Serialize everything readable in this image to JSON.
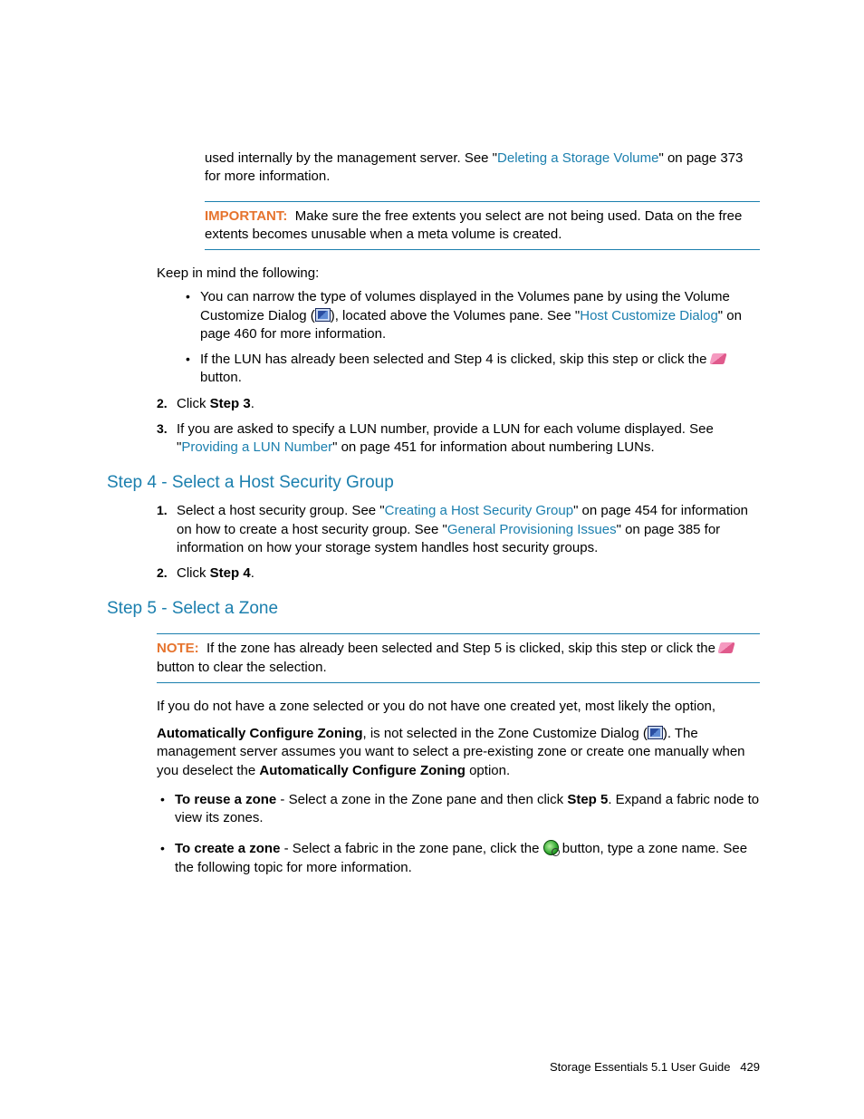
{
  "intro": {
    "p1a": "used internally by the management server. See \"",
    "link1": "Deleting a Storage Volume",
    "p1b": "\" on page 373 for more information."
  },
  "important": {
    "label": "IMPORTANT:",
    "text": "Make sure the free extents you select are not being used. Data on the free extents becomes unusable when a meta volume is created."
  },
  "keep": "Keep in mind the following:",
  "bullets1": {
    "b1a": "You can narrow the type of volumes displayed in the Volumes pane by using the Volume Customize Dialog (",
    "b1b": "), located above the Volumes pane. See \"",
    "b1link": "Host Customize Dialog",
    "b1c": "\" on page 460 for more information.",
    "b2a": "If the LUN has already been selected and Step 4 is clicked, skip this step or click the ",
    "b2b": " button."
  },
  "ol1": {
    "i2a": "Click ",
    "i2b": "Step 3",
    "i2c": ".",
    "i3a": "If you are asked to specify a LUN number, provide a LUN for each volume displayed. See \"",
    "i3link": "Providing a LUN Number",
    "i3b": "\" on page 451 for information about numbering LUNs."
  },
  "step4": {
    "heading": "Step 4 - Select a Host Security Group",
    "i1a": "Select a host security group. See \"",
    "i1link": "Creating a Host Security Group",
    "i1b": "\" on page 454 for information on how to create a host security group. See \"",
    "i1link2": "General Provisioning Issues",
    "i1c": "\" on page 385 for information on how your storage system handles host security groups.",
    "i2a": "Click ",
    "i2b": "Step 4",
    "i2c": "."
  },
  "step5": {
    "heading": "Step 5 - Select a Zone",
    "note_label": "NOTE:",
    "note_a": "If the zone has already been selected and Step 5 is clicked, skip this step or click the ",
    "note_b": " button to clear the selection.",
    "p1": "If you do not have a zone selected or you do not have one created yet, most likely the option,",
    "p2a_bold": "Automatically Configure Zoning",
    "p2a": ", is not selected in the Zone Customize Dialog (",
    "p2b": "). The management server assumes you want to select a pre-existing zone or create one manually when you deselect the ",
    "p2c_bold": "Automatically Configure Zoning",
    "p2d": " option.",
    "b1_bold": "To reuse a zone",
    "b1a": " -  Select a zone in the Zone pane and then click ",
    "b1b_bold": "Step 5",
    "b1c": ". Expand a fabric node to view its zones.",
    "b2_bold": "To create a zone",
    "b2a": " - Select a fabric in the zone pane, click the ",
    "b2b": " button, type a zone name. See the following topic for more information."
  },
  "footer": {
    "title": "Storage Essentials 5.1 User Guide",
    "page": "429"
  }
}
